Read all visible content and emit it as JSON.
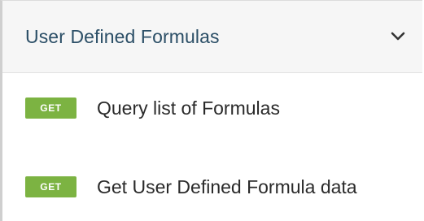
{
  "section": {
    "title": "User Defined Formulas",
    "expand_icon": "chevron-down-icon",
    "expanded": true
  },
  "endpoints": [
    {
      "method": "GET",
      "label": "Query list of Formulas"
    },
    {
      "method": "GET",
      "label": "Get User Defined Formula data"
    }
  ],
  "colors": {
    "get_badge": "#7cb342",
    "header_bg": "#f6f6f6",
    "header_text": "#2c4f67",
    "body_text": "#2a2a2a"
  }
}
